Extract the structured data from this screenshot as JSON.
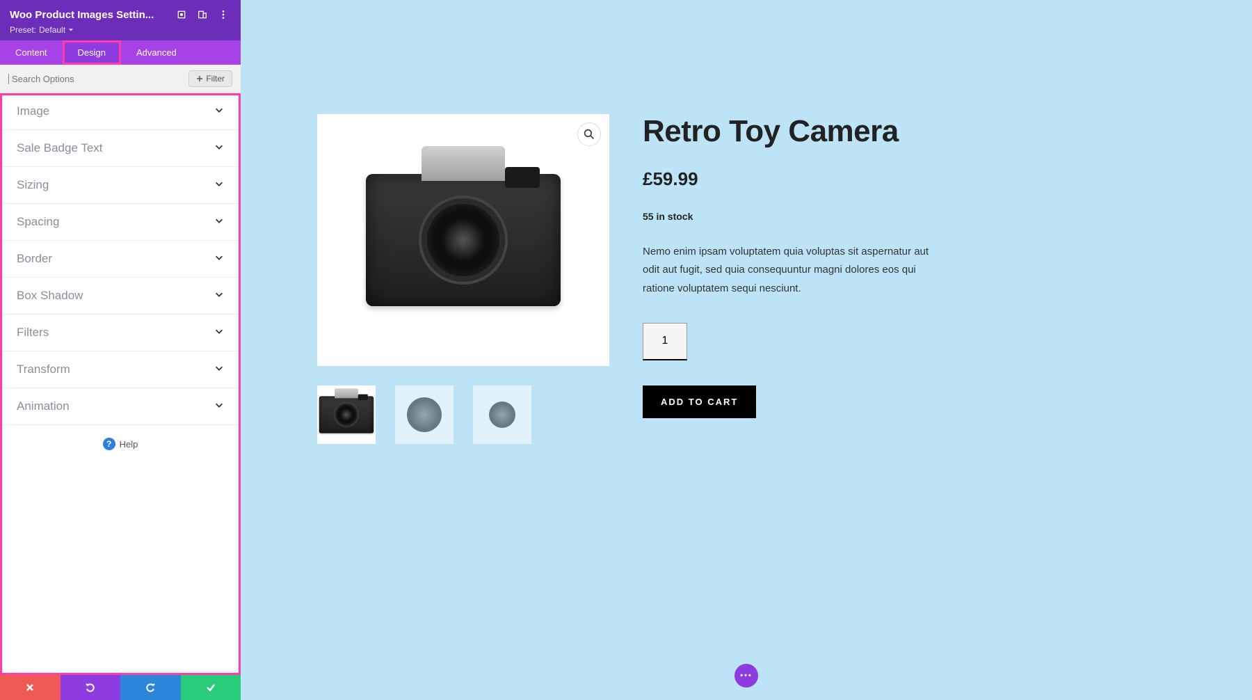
{
  "sidebar": {
    "title": "Woo Product Images Settin...",
    "preset_label": "Preset:",
    "preset_value": "Default",
    "tabs": [
      "Content",
      "Design",
      "Advanced"
    ],
    "active_tab": 1,
    "search_placeholder": "Search Options",
    "filter_label": "Filter",
    "accordion": [
      "Image",
      "Sale Badge Text",
      "Sizing",
      "Spacing",
      "Border",
      "Box Shadow",
      "Filters",
      "Transform",
      "Animation"
    ],
    "help_label": "Help"
  },
  "product": {
    "title": "Retro Toy Camera",
    "price": "£59.99",
    "stock": "55 in stock",
    "description": "Nemo enim ipsam voluptatem quia voluptas sit aspernatur aut odit aut fugit, sed quia consequuntur magni dolores eos qui ratione voluptatem sequi nesciunt.",
    "quantity": "1",
    "add_to_cart": "ADD TO CART"
  },
  "colors": {
    "header": "#6c2eb9",
    "tabs_bg": "#a743e6",
    "highlight": "#ff3da8",
    "preview_bg": "#bde3f7"
  }
}
